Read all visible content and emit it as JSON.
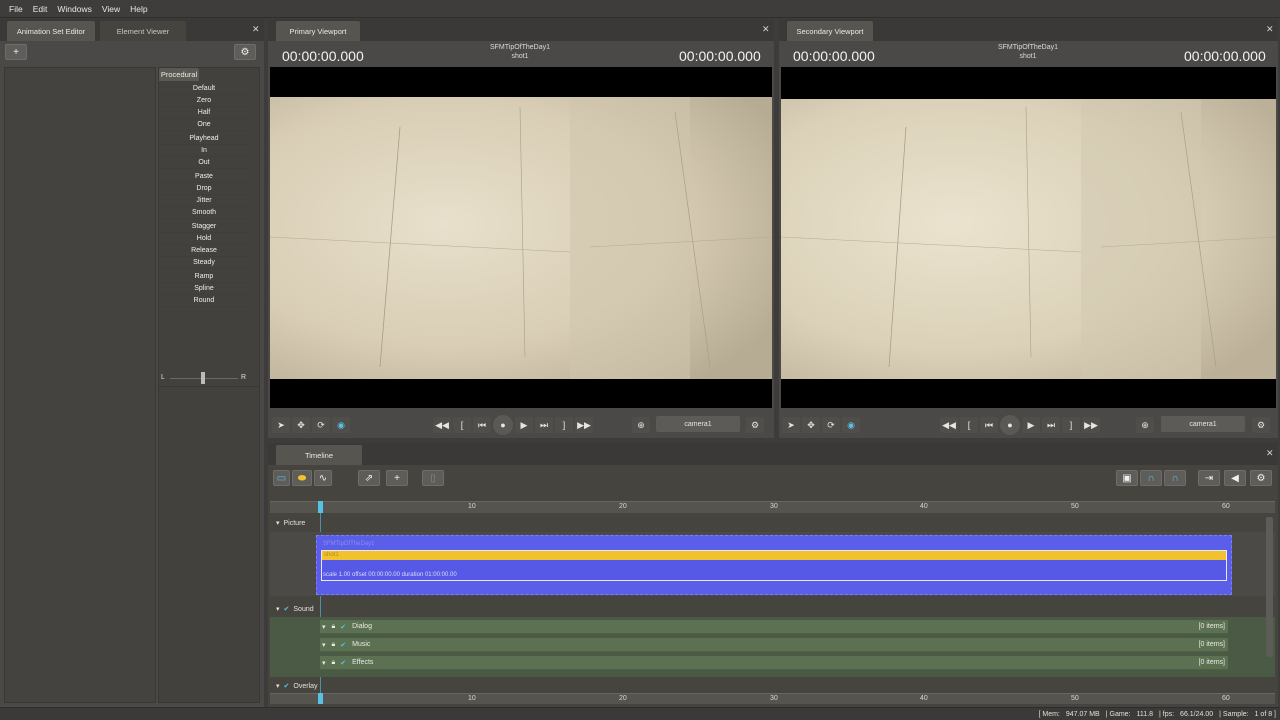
{
  "menu": [
    "File",
    "Edit",
    "Windows",
    "View",
    "Help"
  ],
  "left_panel": {
    "tabs": [
      "Animation Set Editor",
      "Element Viewer"
    ],
    "add_label": "+",
    "procedural_tab": "Procedural",
    "procedural_items": [
      "Default",
      "Zero",
      "Half",
      "One",
      "Playhead",
      "In",
      "Out",
      "Paste",
      "Drop",
      "Jitter",
      "Smooth",
      "Stagger",
      "Hold",
      "Release",
      "Steady",
      "Ramp",
      "Spline",
      "Round"
    ],
    "balance": {
      "left": "L",
      "right": "R"
    }
  },
  "primary": {
    "tab": "Primary Viewport",
    "timecode_left": "00:00:00.000",
    "timecode_right": "00:00:00.000",
    "title": "SFMTipOfTheDay1",
    "shot": "shot1",
    "camera": "camera1"
  },
  "secondary": {
    "tab": "Secondary Viewport",
    "timecode_left": "00:00:00.000",
    "timecode_right": "00:00:00.000",
    "title": "SFMTipOfTheDay1",
    "shot": "shot1",
    "camera": "camera1"
  },
  "timeline": {
    "tab": "Timeline",
    "ruler_labels": [
      "10",
      "20",
      "30",
      "40",
      "50",
      "60"
    ],
    "picture_label": "Picture",
    "clip_name": "SFMTipOfTheDay1",
    "clip_shot": "shot1",
    "clip_info": "scale 1.00 offset  00:00:00.00 duration  01:00:00.00",
    "sound_label": "Sound",
    "sound_tracks": [
      {
        "name": "Dialog",
        "count": "[0 items]"
      },
      {
        "name": "Music",
        "count": "[0 items]"
      },
      {
        "name": "Effects",
        "count": "[0 items]"
      }
    ],
    "overlay_label": "Overlay"
  },
  "status": {
    "mem": "[ Mem:",
    "mem_val": "947.07 MB",
    "game": "| Game:",
    "game_val": "111.8",
    "fps": "| fps:",
    "fps_val": "66.1/24.00",
    "sample": "| Sample:",
    "sample_val": "1 of 8 ]"
  },
  "colors": {
    "clip_blue": "#5a5ee8",
    "clip_yellow": "#f2c12e",
    "sound_green": "#5c7152",
    "accent_cyan": "#59c1e6"
  }
}
